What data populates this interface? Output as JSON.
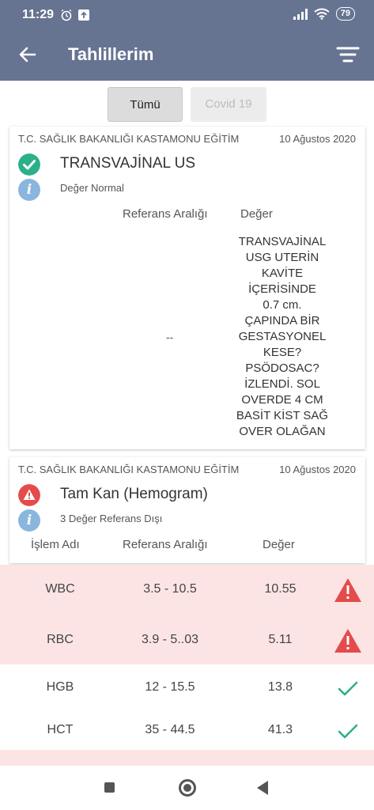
{
  "status_bar": {
    "time": "11:29",
    "battery": "79"
  },
  "app_bar": {
    "title": "Tahlillerim"
  },
  "tabs": [
    {
      "label": "Tümü"
    },
    {
      "label": "Covid 19"
    }
  ],
  "cards": [
    {
      "institution": "T.C. SAĞLIK BAKANLIĞI KASTAMONU EĞİTİM",
      "date": "10 Ağustos 2020",
      "status": "ok",
      "test_name": "TRANSVAJİNAL US",
      "info": "Değer Normal",
      "col_reference": "Referans Aralığı",
      "col_value": "Değer",
      "reference": "--",
      "result": "TRANSVAJİNAL\nUSG UTERİN\nKAVİTE\nİÇERİSİNDE\n0.7  cm.\nÇAPINDA BİR\nGESTASYONEL\nKESE?\nPSÖDOSAC?\nİZLENDİ. SOL\nOVERDE 4 CM\nBASİT KİST SAĞ\nOVER OLAĞAN"
    },
    {
      "institution": "T.C. SAĞLIK BAKANLIĞI KASTAMONU EĞİTİM",
      "date": "10 Ağustos 2020",
      "status": "warning",
      "test_name": "Tam Kan (Hemogram)",
      "info": "3 Değer Referans Dışı",
      "col_name": "İşlem Adı",
      "col_reference": "Referans Aralığı",
      "col_value": "Değer"
    }
  ],
  "hemogram_rows": [
    {
      "name": "WBC",
      "reference": "3.5 - 10.5",
      "value": "10.55",
      "status": "warning"
    },
    {
      "name": "RBC",
      "reference": "3.9 - 5..03",
      "value": "5.11",
      "status": "warning"
    },
    {
      "name": "HGB",
      "reference": "12 - 15.5",
      "value": "13.8",
      "status": "ok"
    },
    {
      "name": "HCT",
      "reference": "35 - 44.5",
      "value": "41.3",
      "status": "ok"
    }
  ],
  "colors": {
    "header": "#667391",
    "ok": "#2bb08a",
    "warning": "#e54b4b",
    "info": "#8ab6de",
    "bad_row": "#fce4e4"
  }
}
